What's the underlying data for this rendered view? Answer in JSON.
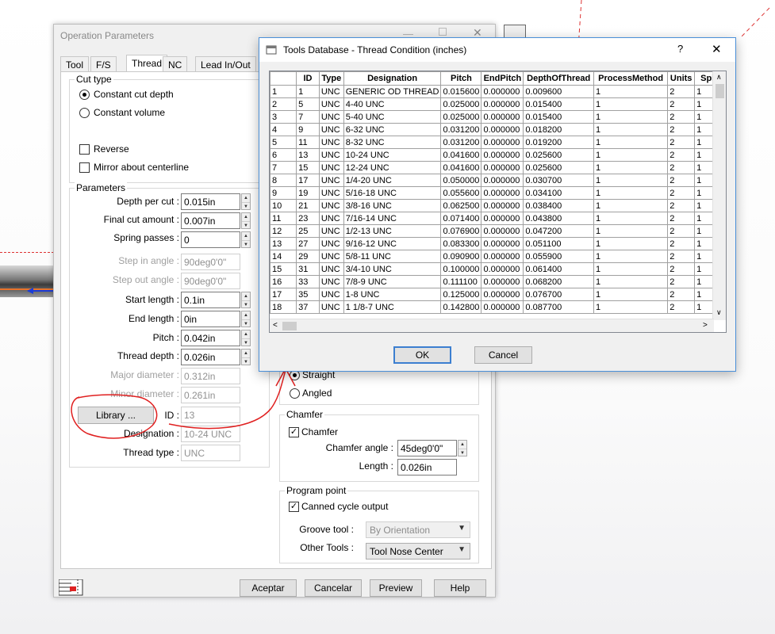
{
  "op_window": {
    "title": "Operation Parameters",
    "tabs": [
      "Tool",
      "F/S",
      "Thread",
      "NC",
      "Lead In/Out"
    ],
    "cut_type": {
      "label": "Cut type",
      "option_constant_depth": "Constant cut depth",
      "option_constant_volume": "Constant volume",
      "reverse": "Reverse",
      "mirror": "Mirror about centerline"
    },
    "parameters": {
      "label": "Parameters",
      "depth_per_cut_label": "Depth per cut :",
      "depth_per_cut": "0.015in",
      "final_cut_label": "Final cut amount :",
      "final_cut": "0.007in",
      "spring_passes_label": "Spring passes :",
      "spring_passes": "0",
      "step_in_label": "Step in angle :",
      "step_in": "90deg0'0\"",
      "step_out_label": "Step out angle :",
      "step_out": "90deg0'0\"",
      "start_length_label": "Start length :",
      "start_length": "0.1in",
      "end_length_label": "End length :",
      "end_length": "0in",
      "pitch_label": "Pitch :",
      "pitch": "0.042in",
      "thread_depth_label": "Thread depth :",
      "thread_depth": "0.026in",
      "major_dia_label": "Major diameter :",
      "major_dia": "0.312in",
      "minor_dia_label": "Minor diameter :",
      "minor_dia": "0.261in",
      "library_button": "Library ...",
      "id_label": "ID :",
      "id_value": "13",
      "designation_label": "Designation :",
      "designation": "10-24 UNC",
      "thread_type_label": "Thread type :",
      "thread_type": "UNC"
    },
    "shape": {
      "straight": "Straight",
      "angled": "Angled"
    },
    "chamfer": {
      "label": "Chamfer",
      "checkbox": "Chamfer",
      "angle_label": "Chamfer angle :",
      "angle": "45deg0'0\"",
      "length_label": "Length :",
      "length": "0.026in"
    },
    "program_point": {
      "label": "Program point",
      "canned_cycle": "Canned cycle output",
      "groove_tool_label": "Groove tool :",
      "groove_tool": "By Orientation",
      "other_tools_label": "Other Tools :",
      "other_tools": "Tool Nose Center"
    },
    "buttons": {
      "accept": "Aceptar",
      "cancel": "Cancelar",
      "preview": "Preview",
      "help": "Help"
    }
  },
  "dialog": {
    "title": "Tools Database - Thread Condition (inches)",
    "help_glyph": "?",
    "close_glyph": "✕",
    "columns": [
      "",
      "ID",
      "Type",
      "Designation",
      "Pitch",
      "EndPitch",
      "DepthOfThread",
      "ProcessMethod",
      "Units",
      "Spin"
    ],
    "rows": [
      [
        "1",
        "1",
        "UNC",
        "GENERIC OD THREAD",
        "0.015600",
        "0.000000",
        "0.009600",
        "1",
        "2",
        "1"
      ],
      [
        "2",
        "5",
        "UNC",
        "4-40 UNC",
        "0.025000",
        "0.000000",
        "0.015400",
        "1",
        "2",
        "1"
      ],
      [
        "3",
        "7",
        "UNC",
        "5-40 UNC",
        "0.025000",
        "0.000000",
        "0.015400",
        "1",
        "2",
        "1"
      ],
      [
        "4",
        "9",
        "UNC",
        "6-32 UNC",
        "0.031200",
        "0.000000",
        "0.018200",
        "1",
        "2",
        "1"
      ],
      [
        "5",
        "11",
        "UNC",
        "8-32 UNC",
        "0.031200",
        "0.000000",
        "0.019200",
        "1",
        "2",
        "1"
      ],
      [
        "6",
        "13",
        "UNC",
        "10-24 UNC",
        "0.041600",
        "0.000000",
        "0.025600",
        "1",
        "2",
        "1"
      ],
      [
        "7",
        "15",
        "UNC",
        "12-24 UNC",
        "0.041600",
        "0.000000",
        "0.025600",
        "1",
        "2",
        "1"
      ],
      [
        "8",
        "17",
        "UNC",
        "1/4-20 UNC",
        "0.050000",
        "0.000000",
        "0.030700",
        "1",
        "2",
        "1"
      ],
      [
        "9",
        "19",
        "UNC",
        "5/16-18 UNC",
        "0.055600",
        "0.000000",
        "0.034100",
        "1",
        "2",
        "1"
      ],
      [
        "10",
        "21",
        "UNC",
        "3/8-16 UNC",
        "0.062500",
        "0.000000",
        "0.038400",
        "1",
        "2",
        "1"
      ],
      [
        "11",
        "23",
        "UNC",
        "7/16-14 UNC",
        "0.071400",
        "0.000000",
        "0.043800",
        "1",
        "2",
        "1"
      ],
      [
        "12",
        "25",
        "UNC",
        "1/2-13 UNC",
        "0.076900",
        "0.000000",
        "0.047200",
        "1",
        "2",
        "1"
      ],
      [
        "13",
        "27",
        "UNC",
        "9/16-12 UNC",
        "0.083300",
        "0.000000",
        "0.051100",
        "1",
        "2",
        "1"
      ],
      [
        "14",
        "29",
        "UNC",
        "5/8-11 UNC",
        "0.090900",
        "0.000000",
        "0.055900",
        "1",
        "2",
        "1"
      ],
      [
        "15",
        "31",
        "UNC",
        "3/4-10 UNC",
        "0.100000",
        "0.000000",
        "0.061400",
        "1",
        "2",
        "1"
      ],
      [
        "16",
        "33",
        "UNC",
        "7/8-9 UNC",
        "0.111100",
        "0.000000",
        "0.068200",
        "1",
        "2",
        "1"
      ],
      [
        "17",
        "35",
        "UNC",
        "1-8 UNC",
        "0.125000",
        "0.000000",
        "0.076700",
        "1",
        "2",
        "1"
      ],
      [
        "18",
        "37",
        "UNC",
        "1 1/8-7 UNC",
        "0.142800",
        "0.000000",
        "0.087700",
        "1",
        "2",
        "1"
      ]
    ],
    "ok": "OK",
    "cancel": "Cancel"
  },
  "colors": {
    "annotation_red": "#e02020",
    "dialog_border": "#4a8fd8",
    "ok_border": "#3c7fd0"
  }
}
